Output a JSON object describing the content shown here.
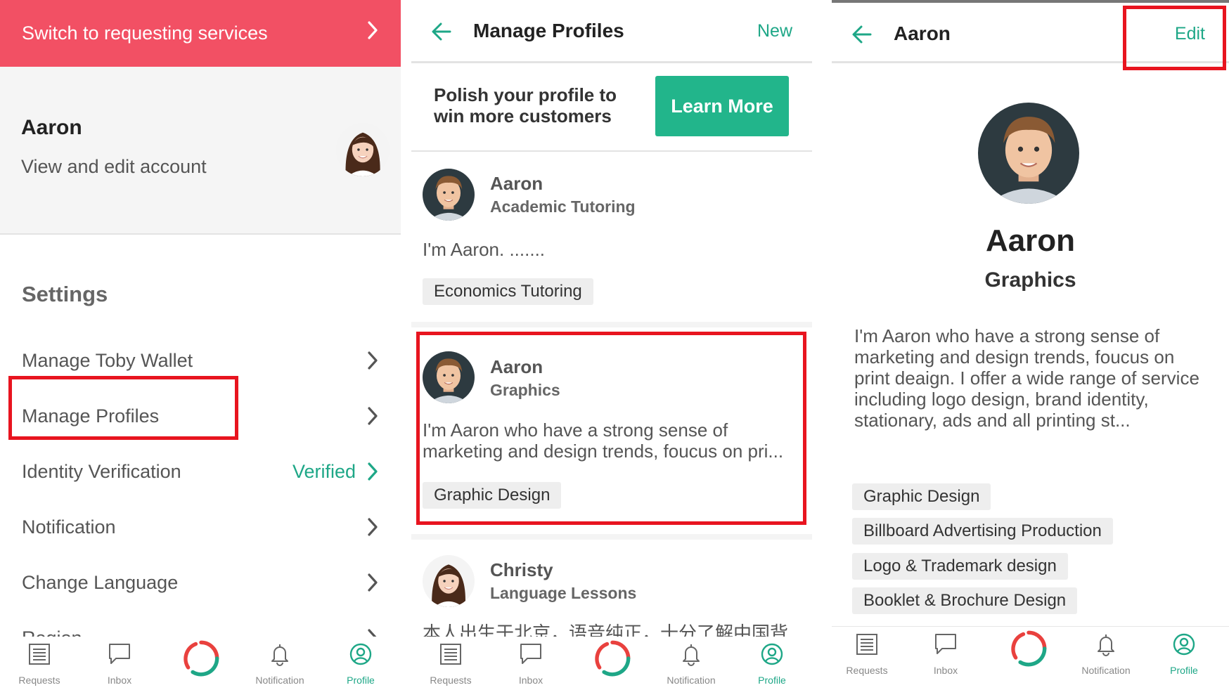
{
  "panel1": {
    "switch_label": "Switch to requesting services",
    "account": {
      "name": "Aaron",
      "subtitle": "View and edit account"
    },
    "settings_title": "Settings",
    "items": [
      {
        "label": "Manage Toby Wallet",
        "value": ""
      },
      {
        "label": "Manage Profiles",
        "value": ""
      },
      {
        "label": "Identity Verification",
        "value": "Verified"
      },
      {
        "label": "Notification",
        "value": ""
      },
      {
        "label": "Change Language",
        "value": ""
      },
      {
        "label": "Region",
        "value": ""
      }
    ]
  },
  "panel2": {
    "title": "Manage Profiles",
    "action": "New",
    "promo_text": "Polish your profile to win more customers",
    "promo_button": "Learn More",
    "profiles": [
      {
        "name": "Aaron",
        "category": "Academic Tutoring",
        "description": "I'm Aaron. .......",
        "tags": [
          "Economics Tutoring"
        ]
      },
      {
        "name": "Aaron",
        "category": "Graphics",
        "description": "I'm Aaron who have a strong sense of marketing and design trends, foucus on pri...",
        "tags": [
          "Graphic Design"
        ]
      },
      {
        "name": "Christy",
        "category": "Language Lessons",
        "description": "本人出生于北京，语音纯正，十分了解中国背",
        "tags": []
      }
    ]
  },
  "panel3": {
    "title": "Aaron",
    "action": "Edit",
    "name": "Aaron",
    "category": "Graphics",
    "description": "I'm Aaron who have a strong sense of marketing and design trends, foucus on print deaign. I offer a wide range of service including logo design, brand identity, stationary, ads and all printing st...",
    "tags": [
      "Graphic Design",
      "Billboard Advertising Production",
      "Logo & Trademark design",
      "Booklet & Brochure Design"
    ]
  },
  "tabbar": {
    "tabs": [
      {
        "label": "Requests",
        "icon": "list-icon"
      },
      {
        "label": "Inbox",
        "icon": "chat-icon"
      },
      {
        "label": "",
        "icon": "toby-logo-icon"
      },
      {
        "label": "Notification",
        "icon": "bell-icon"
      },
      {
        "label": "Profile",
        "icon": "profile-icon"
      }
    ],
    "active": "Profile"
  },
  "colors": {
    "brand_red": "#f25064",
    "accent_green": "#1ea787",
    "button_green": "#22b58b",
    "highlight_red": "#e8141f"
  }
}
